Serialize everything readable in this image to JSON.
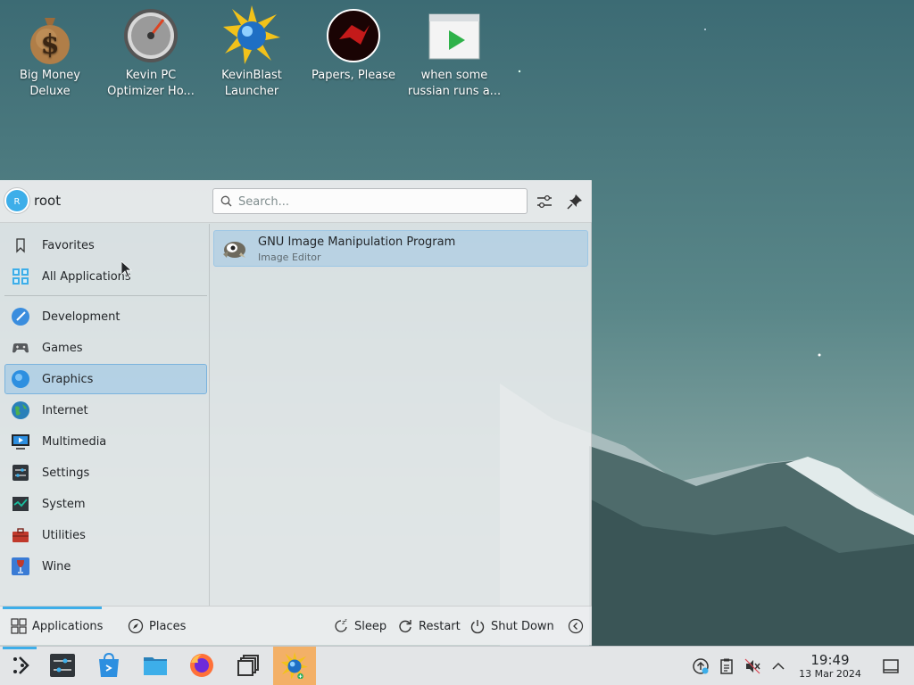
{
  "desktop": {
    "icons": [
      {
        "label": "Big Money\nDeluxe",
        "icon": "money-bag-icon"
      },
      {
        "label": "Kevin PC\nOptimizer Ho...",
        "icon": "speedometer-icon"
      },
      {
        "label": "KevinBlast\nLauncher",
        "icon": "kevinblast-icon"
      },
      {
        "label": "Papers, Please",
        "icon": "papers-please-icon"
      },
      {
        "label": "when some\nrussian runs a...",
        "icon": "video-play-icon"
      }
    ]
  },
  "launcher": {
    "user": {
      "name": "root",
      "initial": "R"
    },
    "search": {
      "placeholder": "Search..."
    },
    "categories": [
      {
        "label": "Favorites",
        "icon": "bookmark-icon"
      },
      {
        "label": "All Applications",
        "icon": "grid-icon"
      },
      {
        "label": "Development",
        "icon": "development-icon"
      },
      {
        "label": "Games",
        "icon": "gamepad-icon"
      },
      {
        "label": "Graphics",
        "icon": "graphics-icon"
      },
      {
        "label": "Internet",
        "icon": "globe-icon"
      },
      {
        "label": "Multimedia",
        "icon": "multimedia-icon"
      },
      {
        "label": "Settings",
        "icon": "settings-icon"
      },
      {
        "label": "System",
        "icon": "system-icon"
      },
      {
        "label": "Utilities",
        "icon": "toolbox-icon"
      },
      {
        "label": "Wine",
        "icon": "wine-icon"
      }
    ],
    "selected_category": "Graphics",
    "apps": [
      {
        "name": "GNU Image Manipulation Program",
        "description": "Image Editor",
        "icon": "gimp-icon"
      }
    ],
    "footer": {
      "applications_label": "Applications",
      "places_label": "Places",
      "sleep_label": "Sleep",
      "restart_label": "Restart",
      "shutdown_label": "Shut Down"
    }
  },
  "taskbar": {
    "clock": {
      "time": "19:49",
      "date": "13 Mar 2024"
    },
    "accent": "#3daee9",
    "active_task_color": "#f3b067"
  }
}
